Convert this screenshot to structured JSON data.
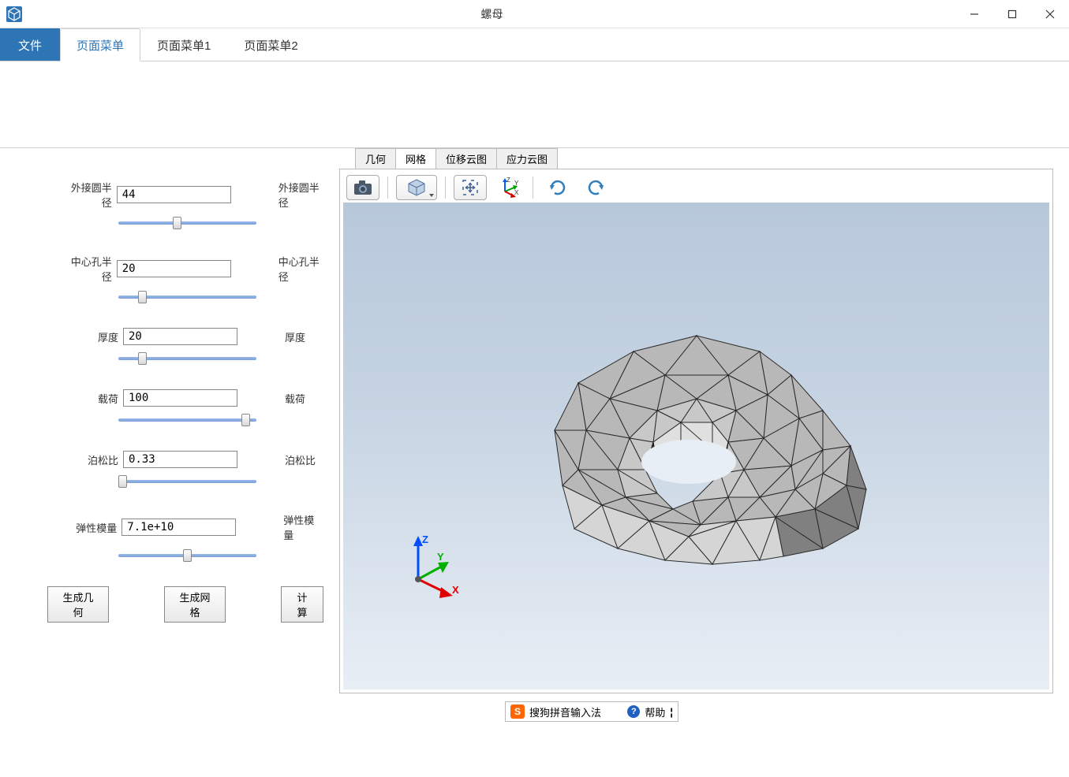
{
  "titlebar": {
    "title": "螺母"
  },
  "menubar": {
    "file": "文件",
    "tabs": [
      "页面菜单",
      "页面菜单1",
      "页面菜单2"
    ],
    "active": 0
  },
  "params": [
    {
      "label": "外接圆半径",
      "value": "44",
      "right": "外接圆半径",
      "thumb_pct": 42
    },
    {
      "label": "中心孔半径",
      "value": "20",
      "right": "中心孔半径",
      "thumb_pct": 15
    },
    {
      "label": "厚度",
      "value": "20",
      "right": "厚度",
      "thumb_pct": 15
    },
    {
      "label": "载荷",
      "value": "100",
      "right": "载荷",
      "thumb_pct": 95
    },
    {
      "label": "泊松比",
      "value": "0.33",
      "right": "泊松比",
      "thumb_pct": 0
    },
    {
      "label": "弹性模量",
      "value": "7.1e+10",
      "right": "弹性模量",
      "thumb_pct": 50
    }
  ],
  "actions": {
    "gen_geom": "生成几何",
    "gen_mesh": "生成网格",
    "compute": "计算"
  },
  "view_tabs": {
    "items": [
      "几何",
      "网格",
      "位移云图",
      "应力云图"
    ],
    "active": 1
  },
  "axes": {
    "x": "X",
    "y": "Y",
    "z": "Z"
  },
  "ime": {
    "name": "搜狗拼音输入法",
    "help": "帮助"
  }
}
